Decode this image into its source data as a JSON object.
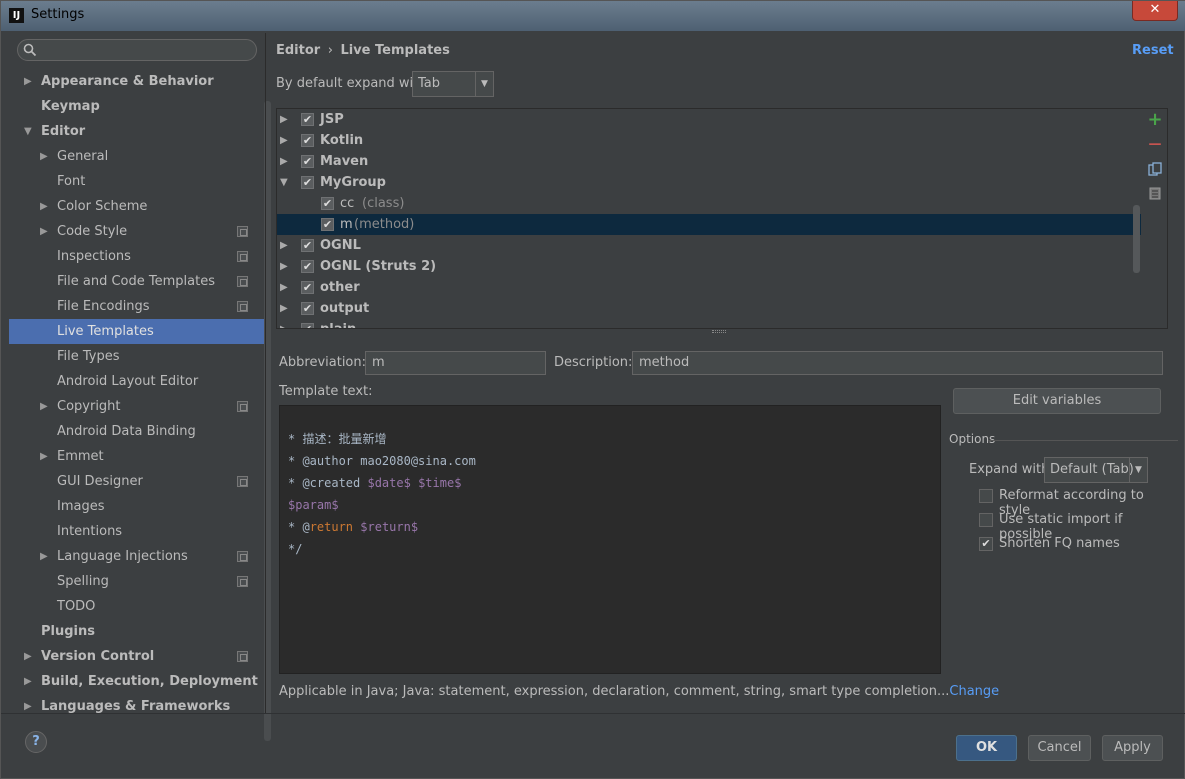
{
  "window": {
    "title": "Settings",
    "close": "✕"
  },
  "sidebar": {
    "items": [
      {
        "label": "Appearance & Behavior",
        "bold": true,
        "level": 0,
        "arrow": "▶",
        "proj": false
      },
      {
        "label": "Keymap",
        "bold": true,
        "level": 0,
        "arrow": "",
        "proj": false
      },
      {
        "label": "Editor",
        "bold": true,
        "level": 0,
        "arrow": "▼",
        "proj": false
      },
      {
        "label": "General",
        "bold": false,
        "level": 1,
        "arrow": "▶",
        "proj": false
      },
      {
        "label": "Font",
        "bold": false,
        "level": 1,
        "arrow": "",
        "proj": false
      },
      {
        "label": "Color Scheme",
        "bold": false,
        "level": 1,
        "arrow": "▶",
        "proj": false
      },
      {
        "label": "Code Style",
        "bold": false,
        "level": 1,
        "arrow": "▶",
        "proj": true
      },
      {
        "label": "Inspections",
        "bold": false,
        "level": 1,
        "arrow": "",
        "proj": true
      },
      {
        "label": "File and Code Templates",
        "bold": false,
        "level": 1,
        "arrow": "",
        "proj": true
      },
      {
        "label": "File Encodings",
        "bold": false,
        "level": 1,
        "arrow": "",
        "proj": true
      },
      {
        "label": "Live Templates",
        "bold": false,
        "level": 1,
        "arrow": "",
        "proj": false,
        "selected": true
      },
      {
        "label": "File Types",
        "bold": false,
        "level": 1,
        "arrow": "",
        "proj": false
      },
      {
        "label": "Android Layout Editor",
        "bold": false,
        "level": 1,
        "arrow": "",
        "proj": false
      },
      {
        "label": "Copyright",
        "bold": false,
        "level": 1,
        "arrow": "▶",
        "proj": true
      },
      {
        "label": "Android Data Binding",
        "bold": false,
        "level": 1,
        "arrow": "",
        "proj": false
      },
      {
        "label": "Emmet",
        "bold": false,
        "level": 1,
        "arrow": "▶",
        "proj": false
      },
      {
        "label": "GUI Designer",
        "bold": false,
        "level": 1,
        "arrow": "",
        "proj": true
      },
      {
        "label": "Images",
        "bold": false,
        "level": 1,
        "arrow": "",
        "proj": false
      },
      {
        "label": "Intentions",
        "bold": false,
        "level": 1,
        "arrow": "",
        "proj": false
      },
      {
        "label": "Language Injections",
        "bold": false,
        "level": 1,
        "arrow": "▶",
        "proj": true
      },
      {
        "label": "Spelling",
        "bold": false,
        "level": 1,
        "arrow": "",
        "proj": true
      },
      {
        "label": "TODO",
        "bold": false,
        "level": 1,
        "arrow": "",
        "proj": false
      },
      {
        "label": "Plugins",
        "bold": true,
        "level": 0,
        "arrow": "",
        "proj": false
      },
      {
        "label": "Version Control",
        "bold": true,
        "level": 0,
        "arrow": "▶",
        "proj": true
      },
      {
        "label": "Build, Execution, Deployment",
        "bold": true,
        "level": 0,
        "arrow": "▶",
        "proj": false
      },
      {
        "label": "Languages & Frameworks",
        "bold": true,
        "level": 0,
        "arrow": "▶",
        "proj": false
      }
    ]
  },
  "header": {
    "crumb_parent": "Editor",
    "crumb_sep": "›",
    "crumb_current": "Live Templates",
    "reset": "Reset"
  },
  "expand": {
    "label": "By default expand with",
    "value": "Tab"
  },
  "templates": [
    {
      "name": "JSP",
      "arrow": "▶",
      "child": false
    },
    {
      "name": "Kotlin",
      "arrow": "▶",
      "child": false
    },
    {
      "name": "Maven",
      "arrow": "▶",
      "child": false
    },
    {
      "name": "MyGroup",
      "arrow": "▼",
      "child": false
    },
    {
      "name": "cc",
      "desc": "(class)",
      "arrow": "",
      "child": true
    },
    {
      "name": "m",
      "desc": "(method)",
      "arrow": "",
      "child": true,
      "selected": true
    },
    {
      "name": "OGNL",
      "arrow": "▶",
      "child": false
    },
    {
      "name": "OGNL (Struts 2)",
      "arrow": "▶",
      "child": false
    },
    {
      "name": "other",
      "arrow": "▶",
      "child": false
    },
    {
      "name": "output",
      "arrow": "▶",
      "child": false
    },
    {
      "name": "plain",
      "arrow": "▶",
      "child": false
    }
  ],
  "tools": {
    "add": "+",
    "remove": "—"
  },
  "form": {
    "abbr_label": "Abbreviation:",
    "abbr_value": "m",
    "desc_label": "Description:",
    "desc_value": "method",
    "template_label": "Template text:",
    "edit_vars": "Edit variables"
  },
  "template_text": [
    {
      "parts": [
        {
          "t": "* 描述：批量新增",
          "c": ""
        }
      ]
    },
    {
      "parts": [
        {
          "t": "* @author mao2080@sina.com",
          "c": ""
        }
      ]
    },
    {
      "parts": [
        {
          "t": "* @created ",
          "c": ""
        },
        {
          "t": "$date$",
          "c": "purple"
        },
        {
          "t": " ",
          "c": ""
        },
        {
          "t": "$time$",
          "c": "purple"
        }
      ]
    },
    {
      "parts": [
        {
          "t": "$param$",
          "c": "purple"
        }
      ]
    },
    {
      "parts": [
        {
          "t": "* @",
          "c": ""
        },
        {
          "t": "return",
          "c": "orange"
        },
        {
          "t": " ",
          "c": ""
        },
        {
          "t": "$return$",
          "c": "purple"
        }
      ]
    },
    {
      "parts": [
        {
          "t": "*/",
          "c": ""
        }
      ]
    }
  ],
  "options": {
    "title": "Options",
    "expand_label": "Expand with",
    "expand_value": "Default (Tab)",
    "reformat": "Reformat according to style",
    "static_import": "Use static import if possible",
    "shorten": "Shorten FQ names"
  },
  "applicable": {
    "text": "Applicable in Java; Java: statement, expression, declaration, comment, string, smart type completion...",
    "link": "Change"
  },
  "buttons": {
    "ok": "OK",
    "cancel": "Cancel",
    "apply": "Apply"
  },
  "help": "?"
}
